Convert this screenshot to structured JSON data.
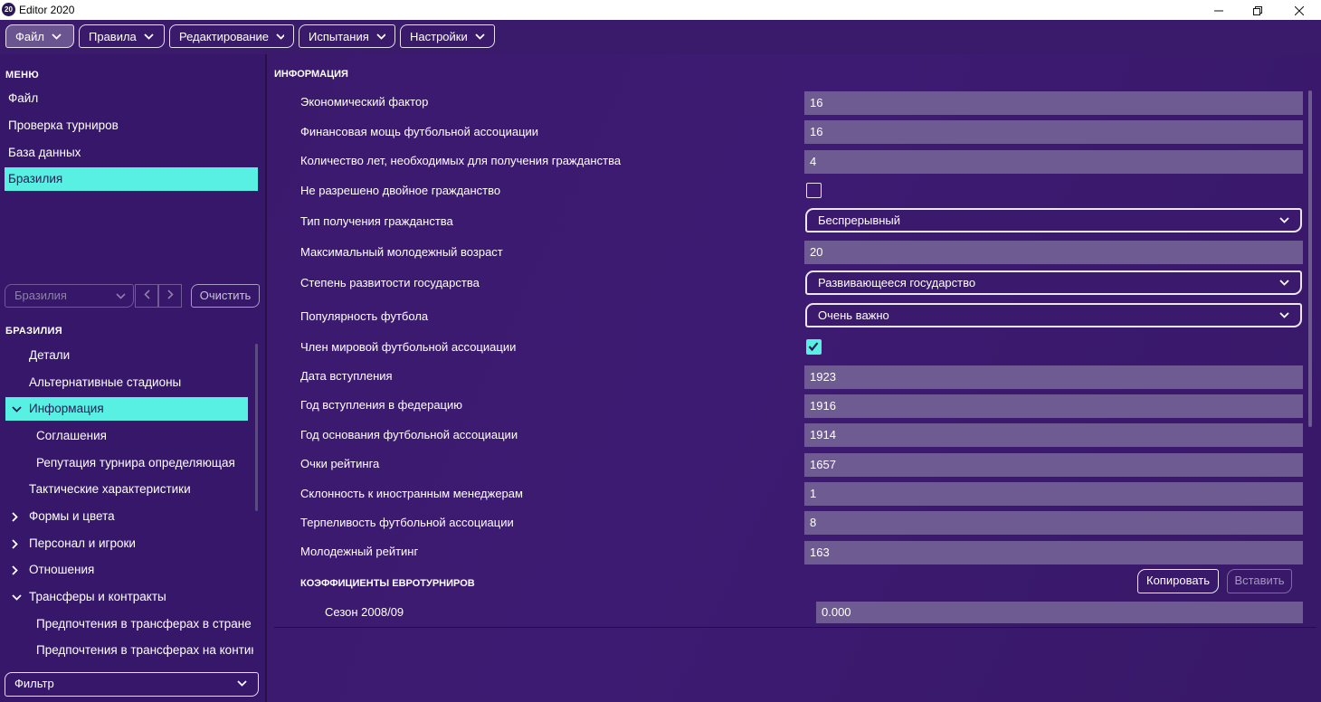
{
  "window": {
    "title": "Editor 2020",
    "icon_text": "20"
  },
  "menubar": {
    "items": [
      {
        "label": "Файл"
      },
      {
        "label": "Правила"
      },
      {
        "label": "Редактирование"
      },
      {
        "label": "Испытания"
      },
      {
        "label": "Настройки"
      }
    ]
  },
  "left": {
    "menu_heading": "МЕНЮ",
    "menu_items": [
      {
        "label": "Файл"
      },
      {
        "label": "Проверка турниров"
      },
      {
        "label": "База данных"
      },
      {
        "label": "Бразилия"
      }
    ],
    "nav_combo": "Бразилия",
    "clear_label": "Очистить",
    "tree_heading": "БРАЗИЛИЯ",
    "tree": [
      {
        "label": "Детали"
      },
      {
        "label": "Альтернативные стадионы"
      },
      {
        "label": "Информация"
      },
      {
        "label": "Соглашения"
      },
      {
        "label": "Репутация турнира определяющая"
      },
      {
        "label": "Тактические характеристики"
      },
      {
        "label": "Формы и цвета"
      },
      {
        "label": "Персонал и игроки"
      },
      {
        "label": "Отношения"
      },
      {
        "label": "Трансферы и контракты"
      },
      {
        "label": "Предпочтения в трансферах в стране"
      },
      {
        "label": "Предпочтения в трансферах на контине"
      }
    ],
    "filter": "Фильтр"
  },
  "info": {
    "heading": "ИНФОРМАЦИЯ",
    "fields": [
      {
        "label": "Экономический фактор",
        "value": "16"
      },
      {
        "label": "Финансовая мощь футбольной ассоциации",
        "value": "16"
      },
      {
        "label": "Количество лет, необходимых для получения гражданства",
        "value": "4"
      },
      {
        "label": "Не разрешено двойное гражданство",
        "checked": false
      },
      {
        "label": "Тип получения гражданства",
        "value": "Беспрерывный"
      },
      {
        "label": "Максимальный молодежный возраст",
        "value": "20"
      },
      {
        "label": "Степень развитости государства",
        "value": "Развивающееся государство"
      },
      {
        "label": "Популярность футбола",
        "value": "Очень важно"
      },
      {
        "label": "Член мировой футбольной ассоциации",
        "checked": true
      },
      {
        "label": "Дата вступления",
        "value": "1923"
      },
      {
        "label": "Год вступления в федерацию",
        "value": "1916"
      },
      {
        "label": "Год основания футбольной ассоциации",
        "value": "1914"
      },
      {
        "label": "Очки рейтинга",
        "value": "1657"
      },
      {
        "label": "Склонность к иностранным менеджерам",
        "value": "1"
      },
      {
        "label": "Терпеливость футбольной ассоциации",
        "value": "8"
      },
      {
        "label": "Молодежный рейтинг",
        "value": "163"
      }
    ],
    "euro_heading": "КОЭФФИЦИЕНТЫ ЕВРОТУРНИРОВ",
    "copy_label": "Копировать",
    "paste_label": "Вставить",
    "season_label": "Сезон 2008/09",
    "season_value": "0.000"
  },
  "colors": {
    "background": "#3a1a6b",
    "accent": "#57f0e2",
    "input_bg": "#6e5b92"
  }
}
